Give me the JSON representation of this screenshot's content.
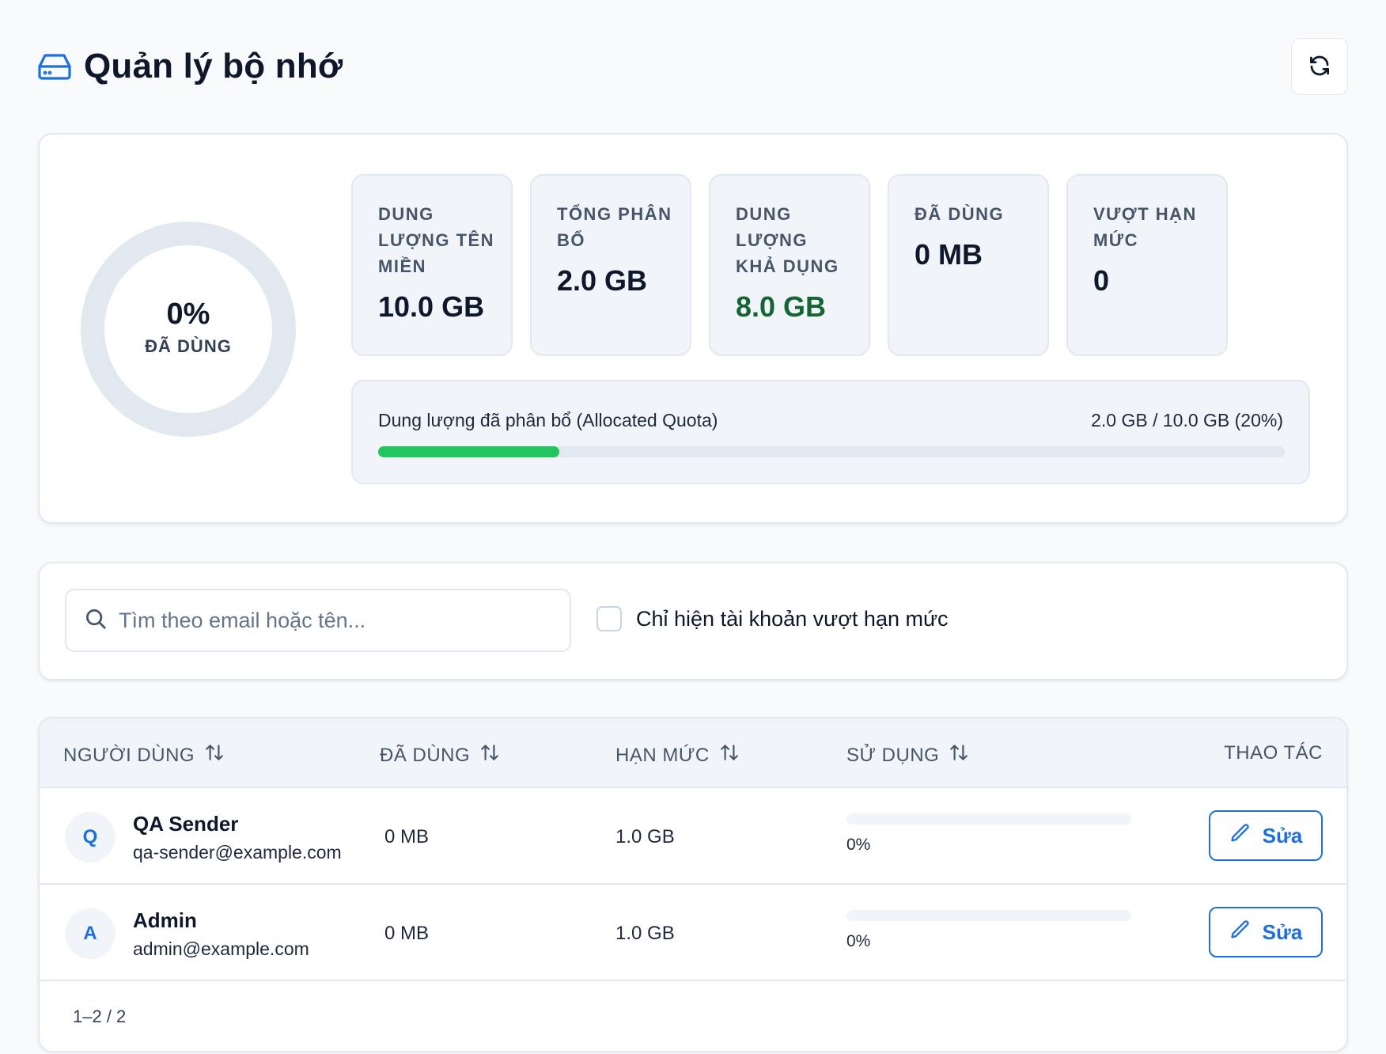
{
  "header": {
    "title": "Quản lý bộ nhớ",
    "title_icon": "hard-drive-icon",
    "refresh_icon": "refresh-icon"
  },
  "summary": {
    "used_percent": 0,
    "donut_percent_label": "0%",
    "donut_caption": "ĐÃ DÙNG",
    "stats": [
      {
        "label": "DUNG LƯỢNG TÊN MIỀN",
        "value": "10.0 GB"
      },
      {
        "label": "TỔNG PHÂN BỔ",
        "value": "2.0 GB"
      },
      {
        "label": "DUNG LƯỢNG KHẢ DỤNG",
        "value": "8.0 GB"
      },
      {
        "label": "ĐÃ DÙNG",
        "value": "0 MB"
      },
      {
        "label": "VƯỢT HẠN MỨC",
        "value": "0"
      }
    ],
    "allocation": {
      "label": "Dung lượng đã phân bổ (Allocated Quota)",
      "value_text": "2.0 GB / 10.0 GB (20%)",
      "percent": 20
    }
  },
  "filter": {
    "search_placeholder": "Tìm theo email hoặc tên...",
    "search_value": "",
    "overquota_only_label": "Chỉ hiện tài khoản vượt hạn mức",
    "overquota_only_checked": false
  },
  "table": {
    "columns": [
      "NGƯỜI DÙNG",
      "ĐÃ DÙNG",
      "HẠN MỨC",
      "SỬ DỤNG",
      "THAO TÁC"
    ],
    "rows": [
      {
        "initial": "Q",
        "name": "QA Sender",
        "email": "qa-sender@example.com",
        "used": "0 MB",
        "quota": "1.0 GB",
        "usage_percent": 0,
        "usage_label": "0%",
        "action": "Sửa"
      },
      {
        "initial": "A",
        "name": "Admin",
        "email": "admin@example.com",
        "used": "0 MB",
        "quota": "1.0 GB",
        "usage_percent": 0,
        "usage_label": "0%",
        "action": "Sửa"
      }
    ],
    "pagination": "1–2 / 2"
  },
  "colors": {
    "accent": "#1d6fe0",
    "progress_green": "#22c55e",
    "available_green": "#166534",
    "donut_track": "#e2e8f0"
  }
}
